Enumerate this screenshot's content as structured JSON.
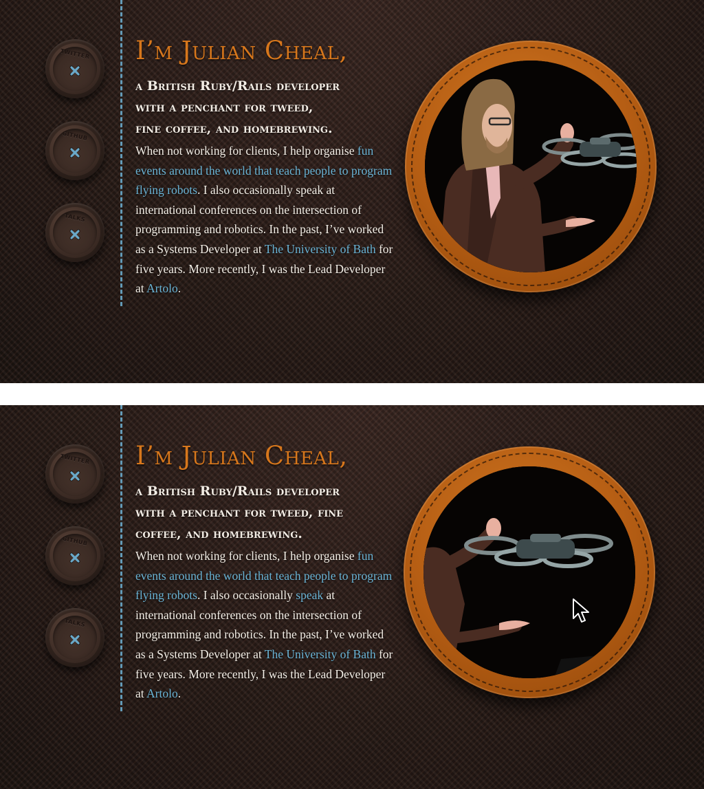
{
  "social_buttons": [
    {
      "label": "TWITTER"
    },
    {
      "label": "GITHUB"
    },
    {
      "label": "TALKS"
    }
  ],
  "colors": {
    "heading_orange": "#d7771c",
    "link_blue": "#6ab4d6",
    "stitch_blue": "#6aa9c9",
    "leather": "#b65e14",
    "tweed_dark": "#2a1d19"
  },
  "top": {
    "headline": "I’m Julian Cheal,",
    "tagline_lines": [
      "a British Ruby/Rails developer",
      "with a penchant for tweed,",
      "fine coffee, and homebrewing."
    ],
    "bio": {
      "p1": "When not working for clients, I help organise ",
      "link_events": "fun events around the world that teach people to program flying robots",
      "p2": ". I also occasionally speak at international conferences on the intersection of programming and robotics. In the past, I’ve worked as a Systems Developer at ",
      "link_bath": "The University of Bath",
      "p3": " for five years. More recently, I was the Lead Developer at ",
      "link_artolo": "Artolo",
      "p4": "."
    }
  },
  "bottom": {
    "headline": "I’m Julian Cheal,",
    "tagline_lines": [
      "a British Ruby/Rails developer",
      "with a penchant for tweed, fine",
      "coffee, and homebrewing."
    ],
    "bio": {
      "p1": "When not working for clients, I help organise ",
      "link_events": "fun events around the world that teach people to program flying robots",
      "p2": ". I also occasionally ",
      "link_speak": "speak",
      "p3": " at international conferences on the intersection of programming and robotics. In the past, I’ve worked as a Systems Developer at ",
      "link_bath": "The University of Bath",
      "p4": " for five years. More recently, I was the Lead Developer at ",
      "link_artolo": "Artolo",
      "p5": "."
    }
  },
  "icons": {
    "button_thread": "cross-stitch-icon",
    "cursor": "arrow-cursor-icon"
  }
}
